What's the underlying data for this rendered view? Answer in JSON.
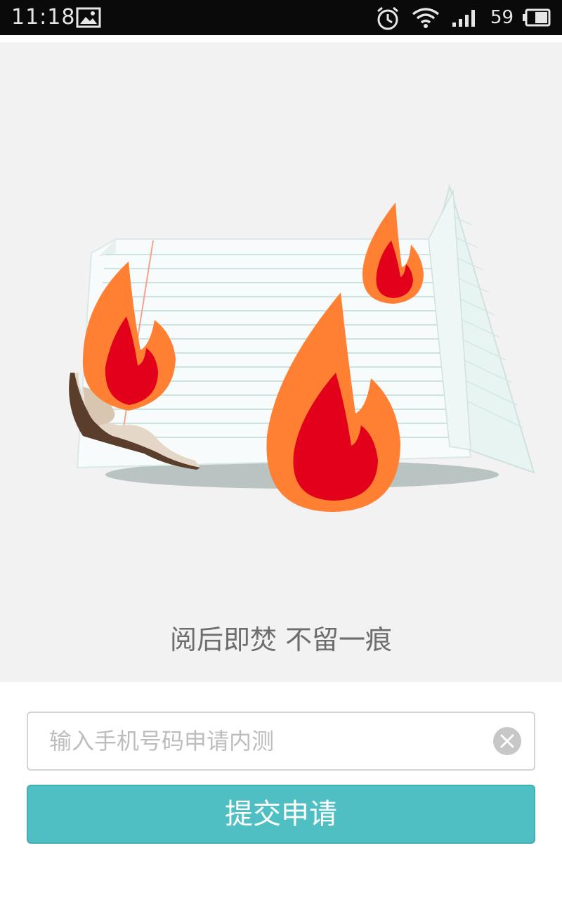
{
  "status_bar": {
    "time": "11:18",
    "battery_level": "59",
    "icons": [
      "image-icon",
      "alarm-icon",
      "wifi-icon",
      "signal-icon",
      "battery-icon"
    ]
  },
  "hero": {
    "tagline": "阅后即焚 不留一痕",
    "illustration_icon": "burning-notepad-illustration",
    "expand_icon": "chevron-up-icon"
  },
  "form": {
    "phone_placeholder": "输入手机号码申请内测",
    "phone_value": "",
    "clear_icon": "clear-icon",
    "submit_label": "提交申请"
  },
  "colors": {
    "accent": "#4fbfc3",
    "hero_background": "#f2f2f2",
    "flame_outer": "#ff7f33",
    "flame_inner": "#e3001a",
    "tagline_text": "#6d6d6d"
  }
}
